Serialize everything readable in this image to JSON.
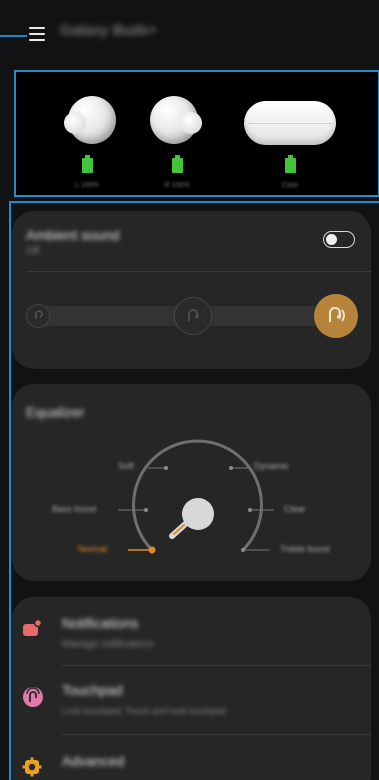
{
  "app": {
    "title": "Galaxy Buds+",
    "menu_icon": "hamburger-menu-icon"
  },
  "devices": {
    "left": {
      "name": "left-earbud",
      "battery_label": "L 100%"
    },
    "right": {
      "name": "right-earbud",
      "battery_label": "R 100%"
    },
    "case": {
      "name": "charging-case",
      "battery_label": "Case"
    },
    "battery_color": "#43c43a"
  },
  "ambient": {
    "title": "Ambient sound",
    "subtitle": "Off",
    "toggle_on": false,
    "levels": [
      "low",
      "medium",
      "high"
    ],
    "selected_level": "high",
    "accent": "#c48a24"
  },
  "equalizer": {
    "title": "Equalizer",
    "presets": [
      "Normal",
      "Bass boost",
      "Soft",
      "Dynamic",
      "Clear",
      "Treble boost"
    ],
    "selected": "Normal",
    "accent": "#e08a2a"
  },
  "menu": {
    "items": [
      {
        "title": "Notifications",
        "subtitle": "Manage notifications",
        "icon": "notifications-icon",
        "color": "#e86a6a"
      },
      {
        "title": "Touchpad",
        "subtitle": "Lock touchpad, Touch and hold touchpad",
        "icon": "touchpad-icon",
        "color": "#e07aa8"
      },
      {
        "title": "Advanced",
        "subtitle": "",
        "icon": "advanced-gear-icon",
        "color": "#e8a020"
      }
    ]
  }
}
